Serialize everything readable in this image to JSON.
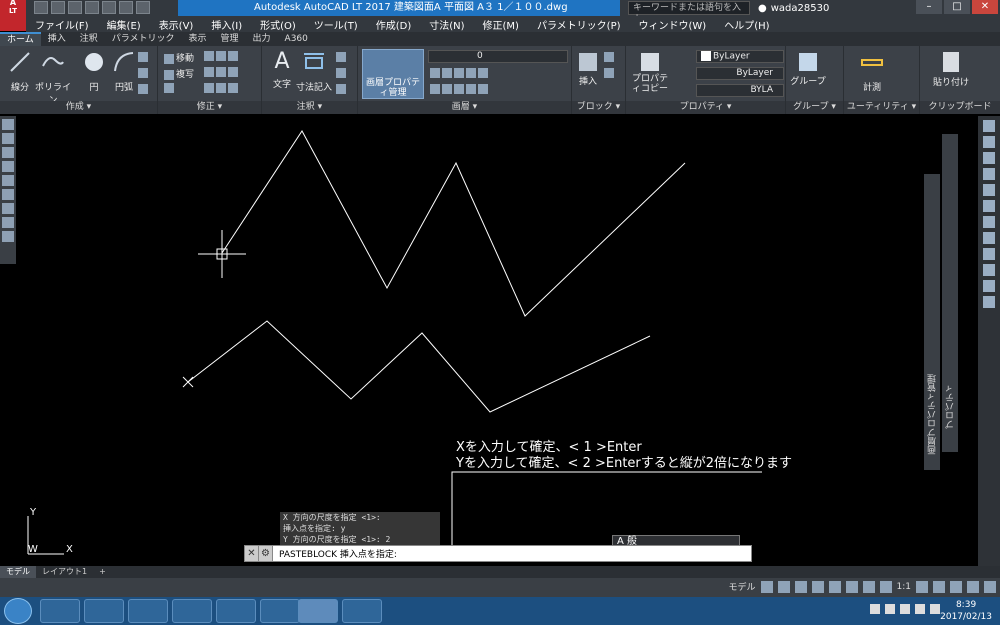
{
  "titlebar": {
    "app_title": "Autodesk AutoCAD LT 2017   建築図面A   平面図   A３   1／１００.dwg",
    "search_placeholder": "キーワードまたは語句を入力",
    "user": "wada28530",
    "logo": "A",
    "logo_sub": "LT"
  },
  "menu": {
    "items": [
      "ファイル(F)",
      "編集(E)",
      "表示(V)",
      "挿入(I)",
      "形式(O)",
      "ツール(T)",
      "作成(D)",
      "寸法(N)",
      "修正(M)",
      "パラメトリック(P)",
      "ウィンドウ(W)",
      "ヘルプ(H)"
    ]
  },
  "ribbon_tabs": [
    "ホーム",
    "挿入",
    "注釈",
    "パラメトリック",
    "表示",
    "管理",
    "出力",
    "A360"
  ],
  "ribbon": {
    "draw": {
      "footer": "作成 ▾",
      "line": "線分",
      "polyline": "ポリライン",
      "circle": "円",
      "arc": "円弧"
    },
    "modify": {
      "footer": "修正 ▾",
      "move": "移動",
      "copy": "複写"
    },
    "annotation": {
      "footer": "注釈 ▾",
      "text": "文字",
      "dimension": "寸法記入"
    },
    "layers": {
      "footer": "画層 ▾",
      "layer_props": "画層プロパティ管理",
      "layer_value": "0"
    },
    "block": {
      "footer": "ブロック ▾",
      "insert": "挿入"
    },
    "properties": {
      "footer": "プロパティ ▾",
      "match": "プロパティコピー",
      "color": "ByLayer",
      "linetype": "ByLayer",
      "lineweight": "BYLA"
    },
    "groups": {
      "footer": "グループ ▾",
      "group": "グループ"
    },
    "utilities": {
      "footer": "ユーティリティ ▾",
      "measure": "計測"
    },
    "clipboard": {
      "footer": "クリップボード",
      "paste": "貼り付け"
    }
  },
  "annotation": {
    "line1": "Xを入力して確定、<  1  >Enter",
    "line2": "Yを入力して確定、<  2  >Enterすると縦が2倍になります"
  },
  "command_history": [
    "X 方向の尺度を指定 <1>:",
    "挿入点を指定: y",
    "Y 方向の尺度を指定 <1>: 2"
  ],
  "command_line": {
    "prompt": "PASTEBLOCK 挿入点を指定:",
    "ime": "A 般"
  },
  "ucs": {
    "y": "Y",
    "w": "W",
    "x": "X"
  },
  "side_panels": {
    "properties": "プロパティ",
    "layer_props": "画層プロパティ管理"
  },
  "layout_tabs": [
    "モデル",
    "レイアウト1",
    "+"
  ],
  "status": {
    "model": "モデル",
    "scale": "1:1"
  },
  "taskbar": {
    "time": "8:39",
    "date": "2017/02/13"
  },
  "drawing": {
    "line_color": "#ffffff",
    "accent_blue": "#1f74c2"
  }
}
